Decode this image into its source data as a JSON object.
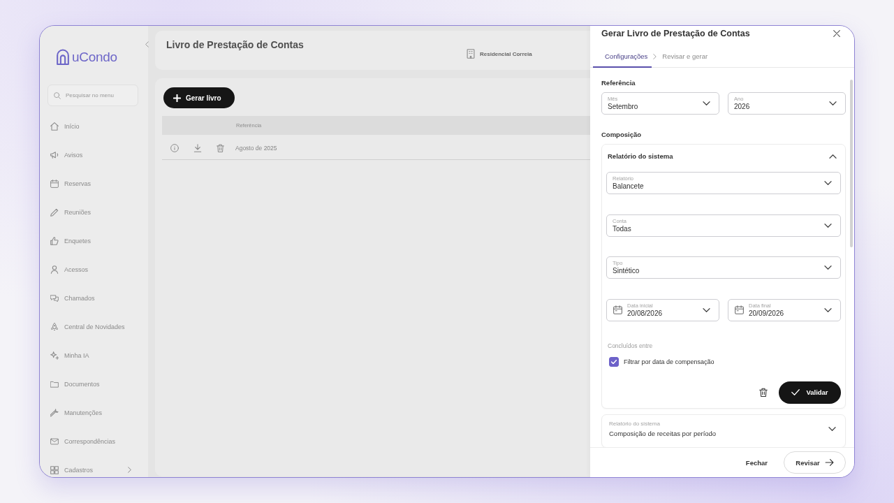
{
  "sidebar": {
    "logo": "uCondo",
    "search": {
      "placeholder": "Pesquisar no menu"
    },
    "items": [
      {
        "label": "Início",
        "has_submenu": false
      },
      {
        "label": "Avisos",
        "has_submenu": false
      },
      {
        "label": "Reservas",
        "has_submenu": false
      },
      {
        "label": "Reuniões",
        "has_submenu": false
      },
      {
        "label": "Enquetes",
        "has_submenu": false
      },
      {
        "label": "Acessos",
        "has_submenu": false
      },
      {
        "label": "Chamados",
        "has_submenu": false
      },
      {
        "label": "Central de Novidades",
        "has_submenu": false
      },
      {
        "label": "Minha IA",
        "has_submenu": false
      },
      {
        "label": "Documentos",
        "has_submenu": false
      },
      {
        "label": "Manutenções",
        "has_submenu": false
      },
      {
        "label": "Correspondências",
        "has_submenu": false
      },
      {
        "label": "Cadastros",
        "has_submenu": true
      }
    ]
  },
  "page": {
    "title": "Livro de Prestação de Contas",
    "condominium": "Residencial Correia",
    "new_button": "Gerar livro",
    "table": {
      "columns": [
        "Referência"
      ],
      "rows": [
        {
          "reference": "Agosto de 2025"
        }
      ]
    }
  },
  "drawer": {
    "title": "Gerar Livro de Prestação de Contas",
    "steps": [
      {
        "label": "Configurações",
        "selected": true
      },
      {
        "label": "Revisar e gerar",
        "selected": false
      }
    ],
    "reference": {
      "heading": "Referência",
      "fields": [
        {
          "label": "Mês",
          "value": "Setembro"
        },
        {
          "label": "Ano",
          "value": "2026"
        }
      ]
    },
    "composition": {
      "heading": "Composição",
      "items": [
        {
          "label": "Relatório do sistema",
          "expanded": true,
          "fields": [
            {
              "label": "Relatório",
              "value": "Balancete"
            },
            {
              "label": "Conta",
              "value": "Todas"
            },
            {
              "label": "Tipo",
              "value": "Sintético"
            }
          ],
          "date_fields": [
            {
              "label": "Data inicial",
              "value": "20/08/2026"
            },
            {
              "label": "Data final",
              "value": "20/09/2026"
            }
          ],
          "range_label": "Concluídos entre",
          "filter": {
            "label": "Filtrar por data de compensação",
            "checked": true
          },
          "validate_button": "Validar"
        },
        {
          "label": "Relatório do sistema",
          "value": "Composição de receitas por período",
          "expanded": false
        }
      ]
    },
    "buttons": {
      "close": "Fechar",
      "review": "Revisar"
    }
  }
}
